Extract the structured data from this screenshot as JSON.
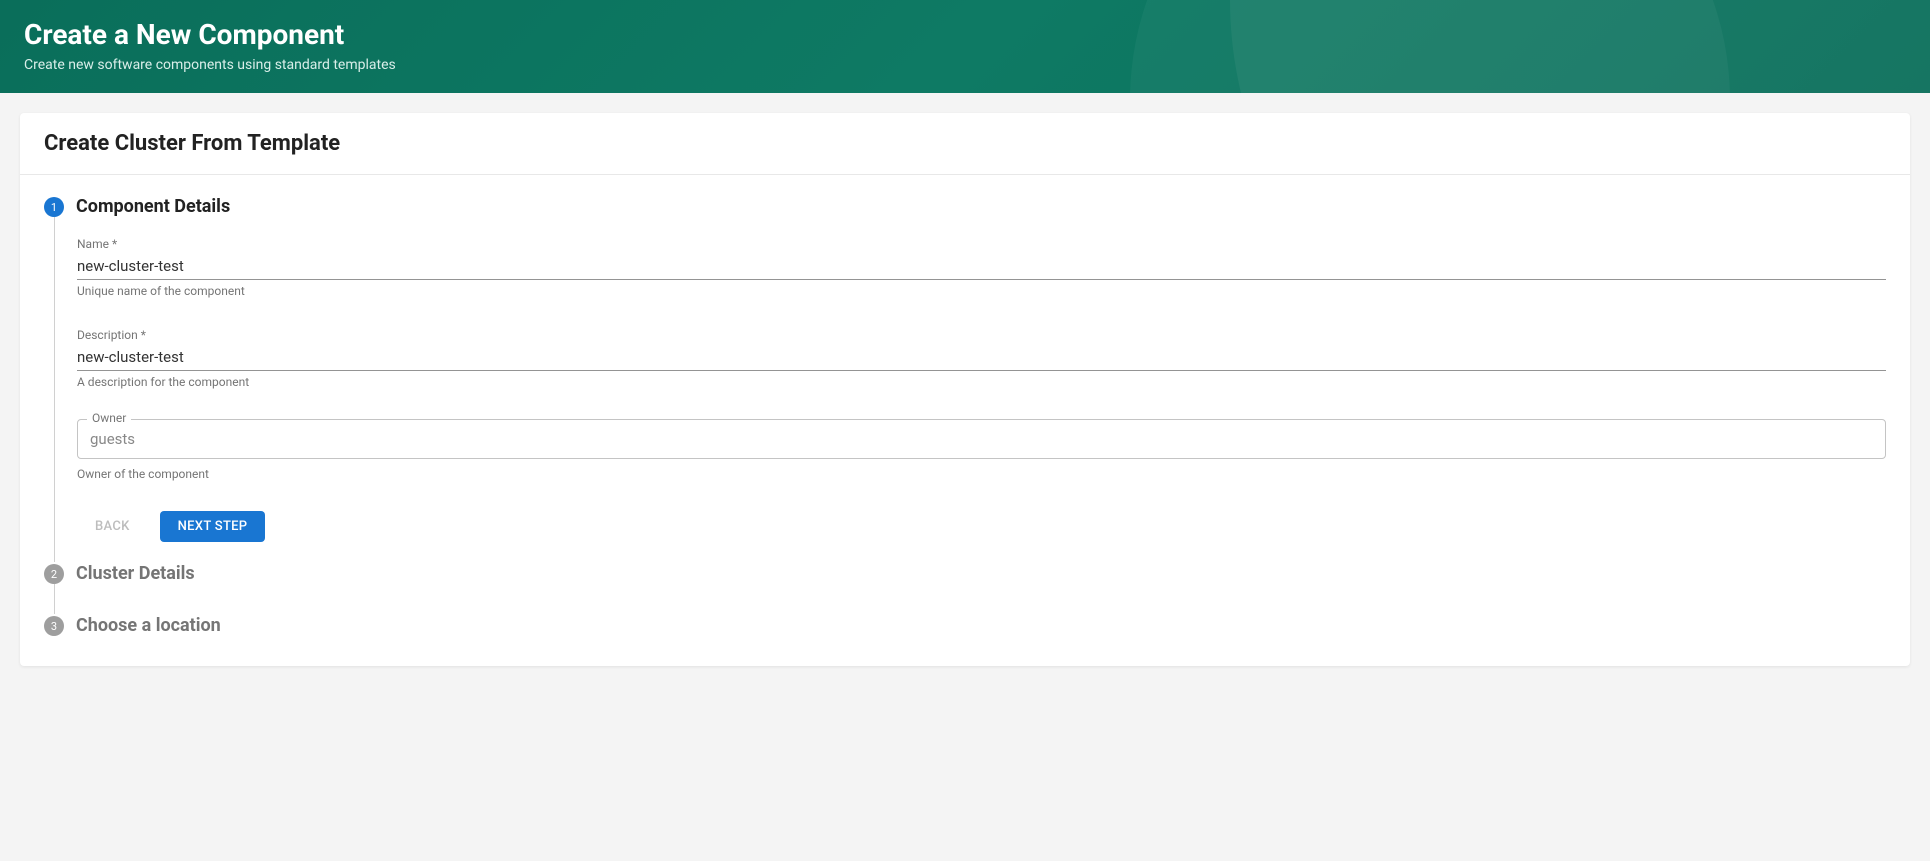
{
  "header": {
    "title": "Create a New Component",
    "subtitle": "Create new software components using standard templates"
  },
  "card": {
    "title": "Create Cluster From Template"
  },
  "steps": [
    {
      "number": "1",
      "label": "Component Details",
      "active": true
    },
    {
      "number": "2",
      "label": "Cluster Details",
      "active": false
    },
    {
      "number": "3",
      "label": "Choose a location",
      "active": false
    }
  ],
  "fields": {
    "name": {
      "label": "Name *",
      "value": "new-cluster-test",
      "helper": "Unique name of the component"
    },
    "description": {
      "label": "Description *",
      "value": "new-cluster-test",
      "helper": "A description for the component"
    },
    "owner": {
      "label": "Owner",
      "value": "guests",
      "helper": "Owner of the component"
    }
  },
  "buttons": {
    "back": "BACK",
    "next": "NEXT STEP"
  }
}
